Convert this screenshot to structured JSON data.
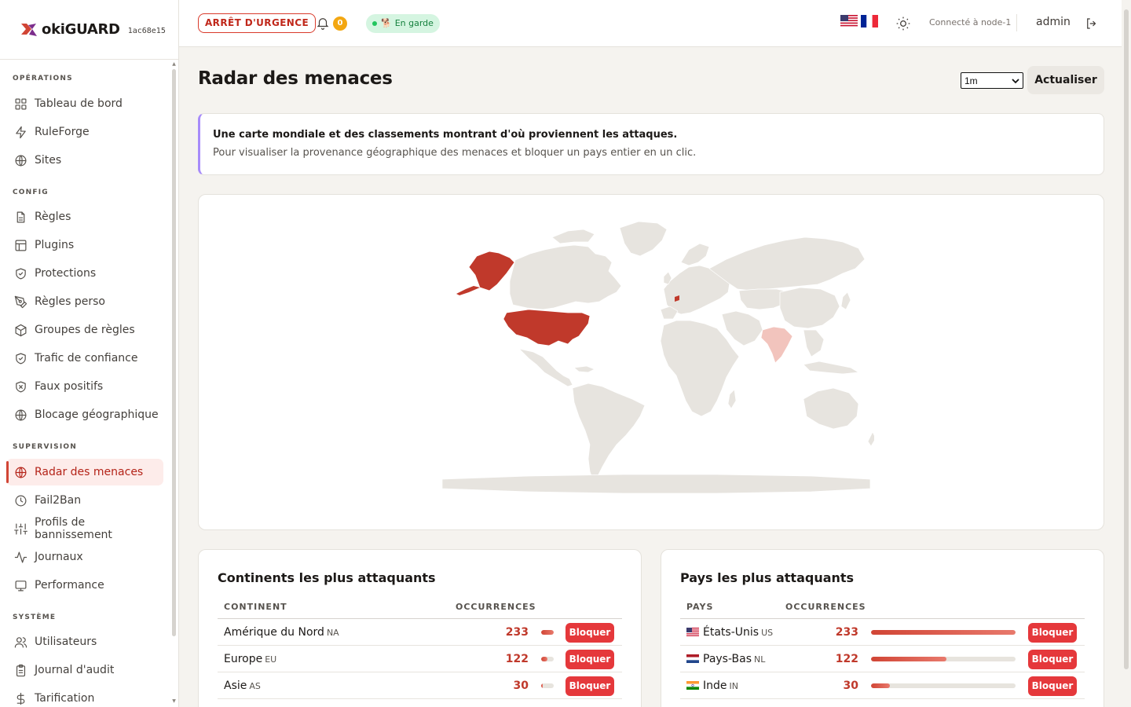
{
  "brand": {
    "name": "okiGUARD",
    "hash": "1ac68e15"
  },
  "sidebar": {
    "sections": [
      {
        "title": "OPÉRATIONS",
        "items": [
          {
            "label": "Tableau de bord",
            "icon": "grid-icon"
          },
          {
            "label": "RuleForge",
            "icon": "bolt-icon"
          },
          {
            "label": "Sites",
            "icon": "globe-icon"
          }
        ]
      },
      {
        "title": "CONFIG",
        "items": [
          {
            "label": "Règles",
            "icon": "file-icon"
          },
          {
            "label": "Plugins",
            "icon": "layout-icon"
          },
          {
            "label": "Protections",
            "icon": "shield-check-icon"
          },
          {
            "label": "Règles perso",
            "icon": "pen-tool-icon"
          },
          {
            "label": "Groupes de règles",
            "icon": "package-icon"
          },
          {
            "label": "Trafic de confiance",
            "icon": "shield-check-icon"
          },
          {
            "label": "Faux positifs",
            "icon": "shield-x-icon"
          },
          {
            "label": "Blocage géographique",
            "icon": "globe-icon"
          }
        ]
      },
      {
        "title": "SUPERVISION",
        "items": [
          {
            "label": "Radar des menaces",
            "icon": "globe-icon",
            "active": true
          },
          {
            "label": "Fail2Ban",
            "icon": "clock-icon"
          },
          {
            "label": "Profils de bannissement",
            "icon": "sliders-icon"
          },
          {
            "label": "Journaux",
            "icon": "activity-icon"
          },
          {
            "label": "Performance",
            "icon": "monitor-icon"
          }
        ]
      },
      {
        "title": "SYSTÈME",
        "items": [
          {
            "label": "Utilisateurs",
            "icon": "users-icon"
          },
          {
            "label": "Journal d'audit",
            "icon": "clipboard-icon"
          },
          {
            "label": "Tarification",
            "icon": "dollar-icon"
          }
        ]
      }
    ]
  },
  "header": {
    "emergency_label": "ARRÊT D'URGENCE",
    "notification_count": "0",
    "status_label": "En garde",
    "status_emoji": "🐕",
    "languages": [
      "en",
      "fr"
    ],
    "connected_label": "Connecté à node-1",
    "user": "admin"
  },
  "main": {
    "title": "Radar des menaces",
    "range": {
      "selected": "1m"
    },
    "refresh_label": "Actualiser",
    "info": {
      "title": "Une carte mondiale et des classements montrant d'où proviennent les attaques.",
      "description": "Pour visualiser la provenance géographique des menaces et bloquer un pays entier en un clic."
    },
    "map": {
      "highlighted": [
        {
          "region": "États-Unis",
          "intensity": "high"
        },
        {
          "region": "Alaska",
          "intensity": "high"
        },
        {
          "region": "Pays-Bas",
          "intensity": "medium"
        },
        {
          "region": "Inde",
          "intensity": "low"
        }
      ],
      "colors": {
        "land": "#e7e4df",
        "high": "#c0392b",
        "low": "#f2c4bd"
      }
    },
    "continents": {
      "title": "Continents les plus attaquants",
      "columns": [
        "CONTINENT",
        "OCCURRENCES"
      ],
      "rows": [
        {
          "name": "Amérique du Nord",
          "code": "NA",
          "count": "233",
          "share": 1.0,
          "action": "Bloquer"
        },
        {
          "name": "Europe",
          "code": "EU",
          "count": "122",
          "share": 0.52,
          "action": "Bloquer"
        },
        {
          "name": "Asie",
          "code": "AS",
          "count": "30",
          "share": 0.13,
          "action": "Bloquer"
        }
      ]
    },
    "countries": {
      "title": "Pays les plus attaquants",
      "columns": [
        "PAYS",
        "OCCURRENCES"
      ],
      "rows": [
        {
          "name": "États-Unis",
          "code": "US",
          "count": "233",
          "share": 1.0,
          "action": "Bloquer",
          "flag": "us-flag"
        },
        {
          "name": "Pays-Bas",
          "code": "NL",
          "count": "122",
          "share": 0.52,
          "action": "Bloquer",
          "flag": "nl-flag"
        },
        {
          "name": "Inde",
          "code": "IN",
          "count": "30",
          "share": 0.13,
          "action": "Bloquer",
          "flag": "in-flag"
        }
      ]
    }
  },
  "colors": {
    "accent": "#d14535",
    "danger_button": "#e5383b",
    "status_bg": "#d5f5e1"
  }
}
